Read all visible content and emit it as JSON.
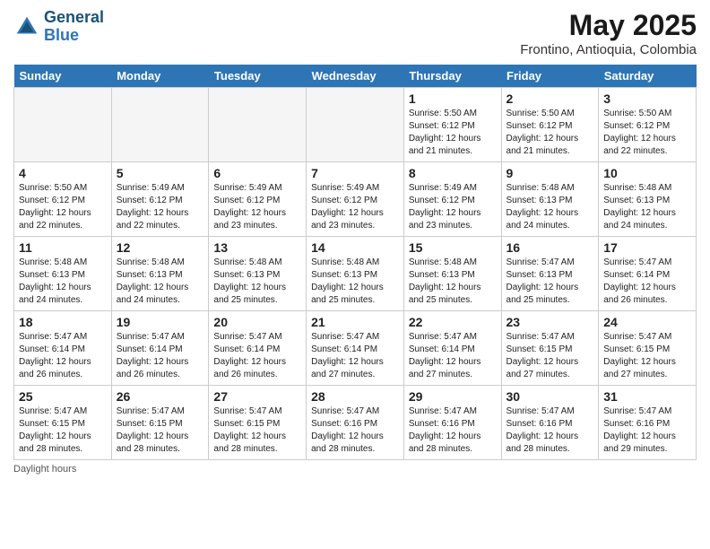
{
  "header": {
    "logo_line1": "General",
    "logo_line2": "Blue",
    "month": "May 2025",
    "location": "Frontino, Antioquia, Colombia"
  },
  "days_of_week": [
    "Sunday",
    "Monday",
    "Tuesday",
    "Wednesday",
    "Thursday",
    "Friday",
    "Saturday"
  ],
  "weeks": [
    [
      {
        "day": "",
        "empty": true
      },
      {
        "day": "",
        "empty": true
      },
      {
        "day": "",
        "empty": true
      },
      {
        "day": "",
        "empty": true
      },
      {
        "day": "1",
        "sunrise": "5:50 AM",
        "sunset": "6:12 PM",
        "daylight": "12 hours and 21 minutes."
      },
      {
        "day": "2",
        "sunrise": "5:50 AM",
        "sunset": "6:12 PM",
        "daylight": "12 hours and 21 minutes."
      },
      {
        "day": "3",
        "sunrise": "5:50 AM",
        "sunset": "6:12 PM",
        "daylight": "12 hours and 22 minutes."
      }
    ],
    [
      {
        "day": "4",
        "sunrise": "5:50 AM",
        "sunset": "6:12 PM",
        "daylight": "12 hours and 22 minutes."
      },
      {
        "day": "5",
        "sunrise": "5:49 AM",
        "sunset": "6:12 PM",
        "daylight": "12 hours and 22 minutes."
      },
      {
        "day": "6",
        "sunrise": "5:49 AM",
        "sunset": "6:12 PM",
        "daylight": "12 hours and 23 minutes."
      },
      {
        "day": "7",
        "sunrise": "5:49 AM",
        "sunset": "6:12 PM",
        "daylight": "12 hours and 23 minutes."
      },
      {
        "day": "8",
        "sunrise": "5:49 AM",
        "sunset": "6:12 PM",
        "daylight": "12 hours and 23 minutes."
      },
      {
        "day": "9",
        "sunrise": "5:48 AM",
        "sunset": "6:13 PM",
        "daylight": "12 hours and 24 minutes."
      },
      {
        "day": "10",
        "sunrise": "5:48 AM",
        "sunset": "6:13 PM",
        "daylight": "12 hours and 24 minutes."
      }
    ],
    [
      {
        "day": "11",
        "sunrise": "5:48 AM",
        "sunset": "6:13 PM",
        "daylight": "12 hours and 24 minutes."
      },
      {
        "day": "12",
        "sunrise": "5:48 AM",
        "sunset": "6:13 PM",
        "daylight": "12 hours and 24 minutes."
      },
      {
        "day": "13",
        "sunrise": "5:48 AM",
        "sunset": "6:13 PM",
        "daylight": "12 hours and 25 minutes."
      },
      {
        "day": "14",
        "sunrise": "5:48 AM",
        "sunset": "6:13 PM",
        "daylight": "12 hours and 25 minutes."
      },
      {
        "day": "15",
        "sunrise": "5:48 AM",
        "sunset": "6:13 PM",
        "daylight": "12 hours and 25 minutes."
      },
      {
        "day": "16",
        "sunrise": "5:47 AM",
        "sunset": "6:13 PM",
        "daylight": "12 hours and 25 minutes."
      },
      {
        "day": "17",
        "sunrise": "5:47 AM",
        "sunset": "6:14 PM",
        "daylight": "12 hours and 26 minutes."
      }
    ],
    [
      {
        "day": "18",
        "sunrise": "5:47 AM",
        "sunset": "6:14 PM",
        "daylight": "12 hours and 26 minutes."
      },
      {
        "day": "19",
        "sunrise": "5:47 AM",
        "sunset": "6:14 PM",
        "daylight": "12 hours and 26 minutes."
      },
      {
        "day": "20",
        "sunrise": "5:47 AM",
        "sunset": "6:14 PM",
        "daylight": "12 hours and 26 minutes."
      },
      {
        "day": "21",
        "sunrise": "5:47 AM",
        "sunset": "6:14 PM",
        "daylight": "12 hours and 27 minutes."
      },
      {
        "day": "22",
        "sunrise": "5:47 AM",
        "sunset": "6:14 PM",
        "daylight": "12 hours and 27 minutes."
      },
      {
        "day": "23",
        "sunrise": "5:47 AM",
        "sunset": "6:15 PM",
        "daylight": "12 hours and 27 minutes."
      },
      {
        "day": "24",
        "sunrise": "5:47 AM",
        "sunset": "6:15 PM",
        "daylight": "12 hours and 27 minutes."
      }
    ],
    [
      {
        "day": "25",
        "sunrise": "5:47 AM",
        "sunset": "6:15 PM",
        "daylight": "12 hours and 28 minutes."
      },
      {
        "day": "26",
        "sunrise": "5:47 AM",
        "sunset": "6:15 PM",
        "daylight": "12 hours and 28 minutes."
      },
      {
        "day": "27",
        "sunrise": "5:47 AM",
        "sunset": "6:15 PM",
        "daylight": "12 hours and 28 minutes."
      },
      {
        "day": "28",
        "sunrise": "5:47 AM",
        "sunset": "6:16 PM",
        "daylight": "12 hours and 28 minutes."
      },
      {
        "day": "29",
        "sunrise": "5:47 AM",
        "sunset": "6:16 PM",
        "daylight": "12 hours and 28 minutes."
      },
      {
        "day": "30",
        "sunrise": "5:47 AM",
        "sunset": "6:16 PM",
        "daylight": "12 hours and 28 minutes."
      },
      {
        "day": "31",
        "sunrise": "5:47 AM",
        "sunset": "6:16 PM",
        "daylight": "12 hours and 29 minutes."
      }
    ]
  ],
  "footer": {
    "daylight_label": "Daylight hours"
  }
}
